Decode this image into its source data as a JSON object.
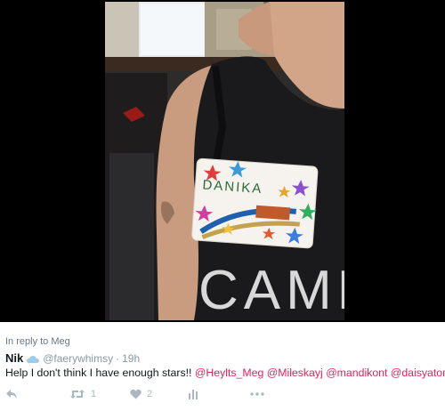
{
  "tweet": {
    "reply_context": "In reply to Meg",
    "author_name": "Nik",
    "author_handle": "@faerywhimsy",
    "separator": "·",
    "timestamp": "19h",
    "text_prefix": "Help I don't think I have enough stars!! ",
    "mentions": [
      "@Heylts_Meg",
      "@Mileskayj",
      "@mandikont",
      "@daisyatomic"
    ],
    "retweet_count": "1",
    "like_count": "2"
  },
  "photo": {
    "name_tag_text": "DANIKA",
    "shirt_text": "CAMEL"
  },
  "colors": {
    "mention": "#e0245e",
    "muted": "#8899a6",
    "action_icon": "#aab8c2",
    "verified_cloud": "#9ecbe8"
  },
  "icons": {
    "reply": "reply-arrow-icon",
    "retweet": "retweet-icon",
    "like": "heart-icon",
    "analytics": "bar-chart-icon",
    "more": "more-dots-icon"
  }
}
